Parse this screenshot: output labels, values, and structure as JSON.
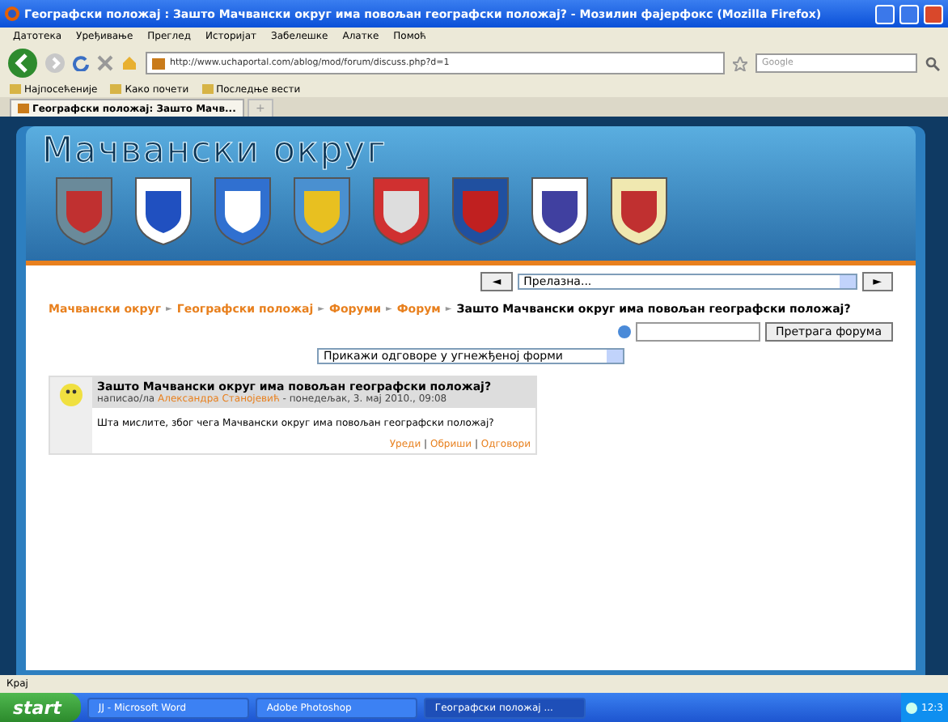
{
  "window": {
    "title": "Географски положај : Зашто Мачвански округ има повољан географски положај? - Мозилин фајерфокс (Mozilla Firefox)"
  },
  "menu": [
    "Датотека",
    "Уређивање",
    "Преглед",
    "Историјат",
    "Забелешке",
    "Алатке",
    "Помоћ"
  ],
  "toolbar": {
    "url": "http://www.uchaportal.com/ablog/mod/forum/discuss.php?d=1",
    "search_placeholder": "Google"
  },
  "bookmarks": [
    "Најпосећеније",
    "Како почети",
    "Последње вести"
  ],
  "tabs": [
    {
      "label": "Географски положај: Зашто Мачв...",
      "selected": true
    }
  ],
  "new_tab": "+",
  "site": {
    "title": "Мачвански округ",
    "nav": {
      "prev": "◄",
      "jump": "Прелазна...",
      "next": "►"
    },
    "breadcrumb": [
      {
        "label": "Мачвански округ",
        "link": true
      },
      {
        "label": "Географски положај",
        "link": true
      },
      {
        "label": "Форуми",
        "link": true
      },
      {
        "label": "Форум",
        "link": true
      },
      {
        "label": "Зашто Мачвански округ има повољан географски положај?",
        "link": false
      }
    ],
    "separator": "►",
    "search_button": "Претрага форума",
    "display_mode": "Прикажи одговоре у угнежђеној форми",
    "post": {
      "title": "Зашто Мачвански округ има повољан географски положај?",
      "by": "написао/ла",
      "author": "Александра Станојевић",
      "date": "- понедељак, 3. мај 2010., 09:08",
      "message": "Шта мислите, због чега Мачвански округ има повољан географски положај?",
      "actions": [
        "Уреди",
        "Обриши",
        "Одговори"
      ],
      "action_separator": "|"
    }
  },
  "status_bar": "Крај",
  "taskbar": {
    "start": "start",
    "items": [
      {
        "label": "ЈЈ - Microsoft Word",
        "selected": false
      },
      {
        "label": "Adobe Photoshop",
        "selected": false
      },
      {
        "label": "Географски положај ...",
        "selected": true
      }
    ],
    "clock": "12:3"
  }
}
